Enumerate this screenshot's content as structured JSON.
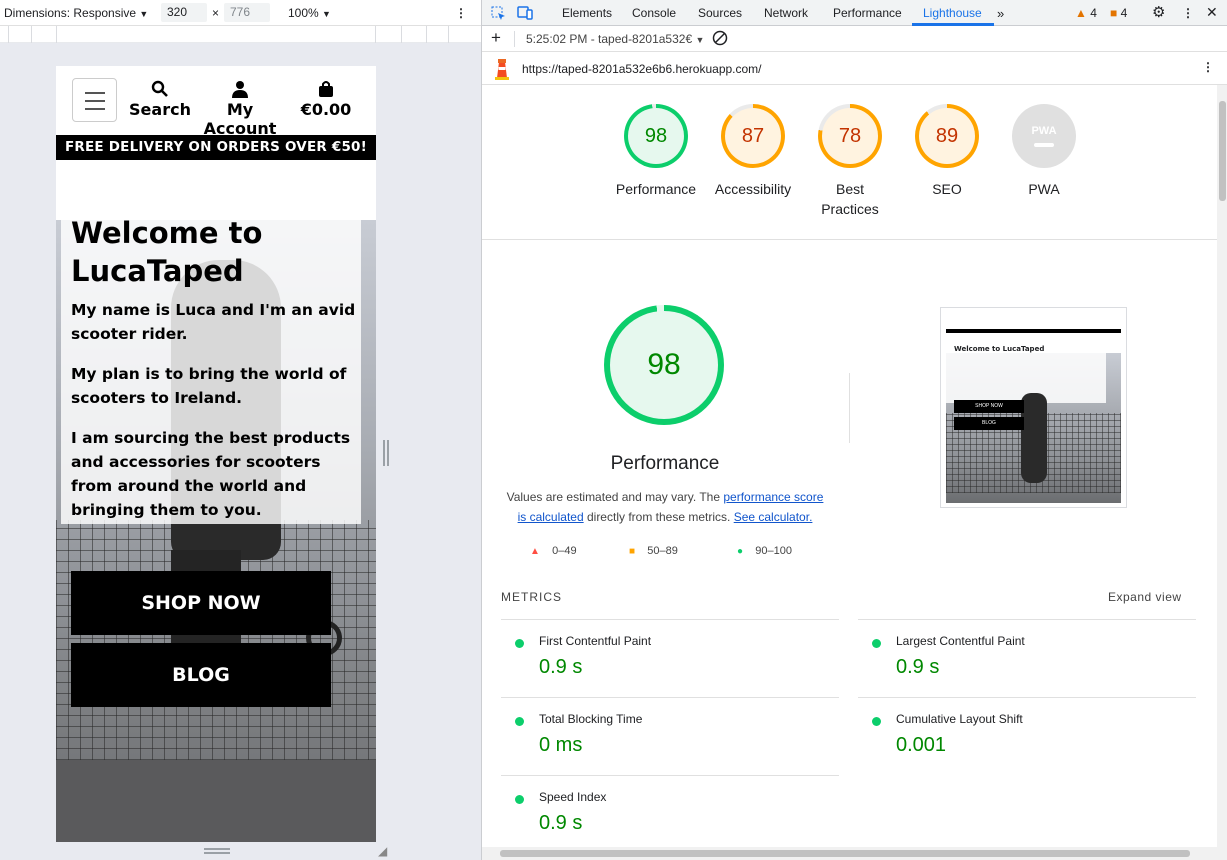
{
  "device_toolbar": {
    "dimensions_label": "Dimensions: Responsive",
    "width": "320",
    "times": "×",
    "height": "776",
    "zoom": "100%"
  },
  "phone": {
    "nav": {
      "search": "Search",
      "account": "My Account",
      "cart": "€0.00"
    },
    "banner": "FREE DELIVERY ON ORDERS OVER €50!",
    "hero": {
      "title": "Welcome to LucaTaped",
      "p1": "My name is Luca and I'm an avid scooter rider.",
      "p2": "My plan is to bring the world of scooters to Ireland.",
      "p3": "I am sourcing the best products and accessories for scooters from around the world and bringing them to you.",
      "shop_button": "SHOP NOW",
      "blog_button": "BLOG"
    }
  },
  "devtools": {
    "tabs": [
      "Elements",
      "Console",
      "Sources",
      "Network",
      "Performance",
      "Lighthouse"
    ],
    "active_tab": "Lighthouse",
    "warnings": "4",
    "errors": "4",
    "report_selector": "5:25:02 PM - taped-8201a532€",
    "url": "https://taped-8201a532e6b6.herokuapp.com/"
  },
  "lighthouse": {
    "scores": [
      {
        "label": "Performance",
        "value": "98",
        "color": "#0cce6b"
      },
      {
        "label": "Accessibility",
        "value": "87",
        "color": "#ffa400"
      },
      {
        "label": "Best Practices",
        "value": "78",
        "color": "#ffa400"
      },
      {
        "label": "SEO",
        "value": "89",
        "color": "#ffa400"
      },
      {
        "label": "PWA",
        "value": "PWA",
        "color": "#e0e0e0"
      }
    ],
    "main_score": "98",
    "main_title": "Performance",
    "note_pre": "Values are estimated and may vary. The ",
    "note_link1": "performance score is calculated",
    "note_mid": " directly from these metrics. ",
    "note_link2": "See calculator.",
    "legend": [
      {
        "range": "0–49",
        "color": "#ff4e42"
      },
      {
        "range": "50–89",
        "color": "#ffa400"
      },
      {
        "range": "90–100",
        "color": "#0cce6b"
      }
    ],
    "metrics_header": "METRICS",
    "expand_view": "Expand view",
    "metrics": [
      {
        "name": "First Contentful Paint",
        "value": "0.9 s"
      },
      {
        "name": "Largest Contentful Paint",
        "value": "0.9 s"
      },
      {
        "name": "Total Blocking Time",
        "value": "0 ms"
      },
      {
        "name": "Cumulative Layout Shift",
        "value": "0.001"
      },
      {
        "name": "Speed Index",
        "value": "0.9 s"
      }
    ],
    "thumbnail": {
      "title": "Welcome to LucaTaped",
      "btn1": "SHOP NOW",
      "btn2": "BLOG"
    }
  }
}
